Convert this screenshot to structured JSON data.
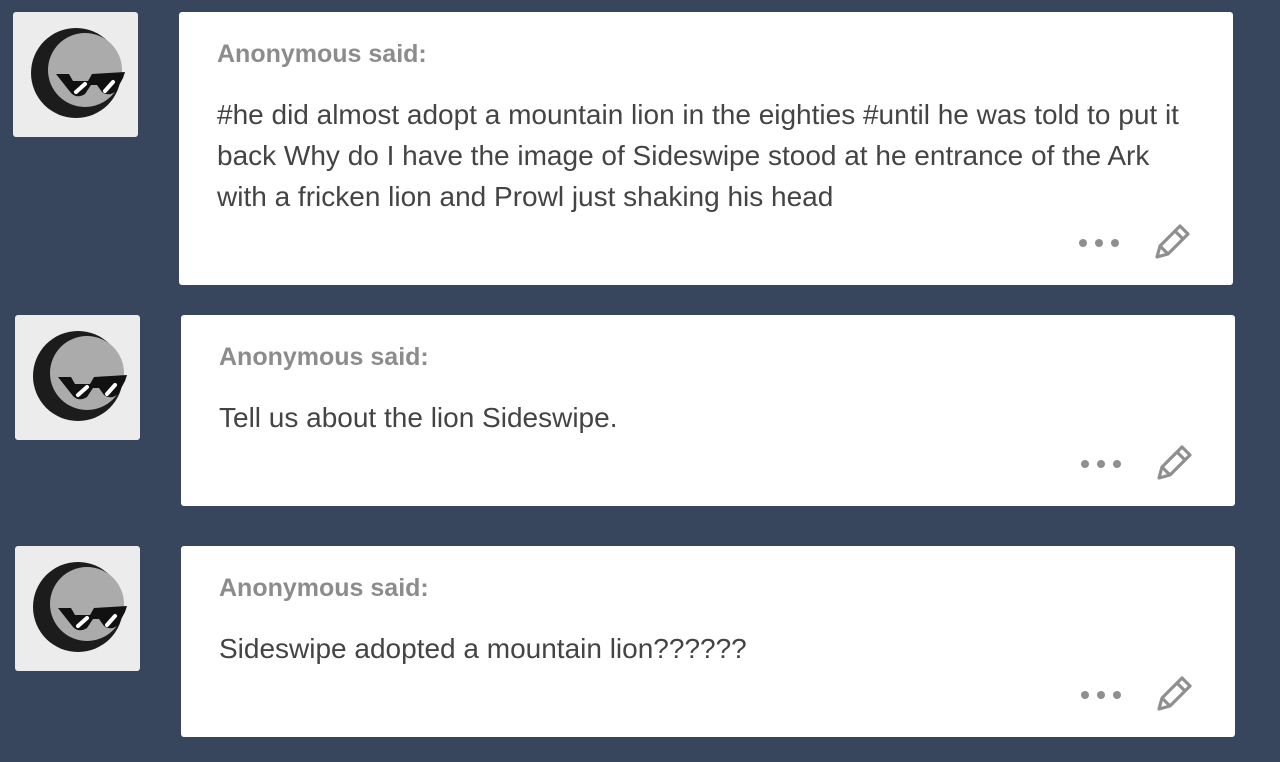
{
  "posts": [
    {
      "asker": "Anonymous said:",
      "question": "#he did almost adopt a mountain lion in the eighties #until he was told to put it back Why do I have the image of Sideswipe stood at he entrance of the Ark with a fricken lion and Prowl just shaking his head",
      "avatar_icon": "sunglasses-moon-avatar-icon",
      "more_icon": "ellipsis-icon",
      "edit_icon": "pencil-icon"
    },
    {
      "asker": "Anonymous said:",
      "question": "Tell us about the lion Sideswipe.",
      "avatar_icon": "sunglasses-moon-avatar-icon",
      "more_icon": "ellipsis-icon",
      "edit_icon": "pencil-icon"
    },
    {
      "asker": "Anonymous said:",
      "question": "Sideswipe adopted a mountain lion??????",
      "avatar_icon": "sunglasses-moon-avatar-icon",
      "more_icon": "ellipsis-icon",
      "edit_icon": "pencil-icon"
    }
  ],
  "colors": {
    "background": "#37465c",
    "card": "#ffffff",
    "asker_text": "#8c8c8c",
    "question_text": "#444444",
    "icon": "#8f8f8f"
  }
}
